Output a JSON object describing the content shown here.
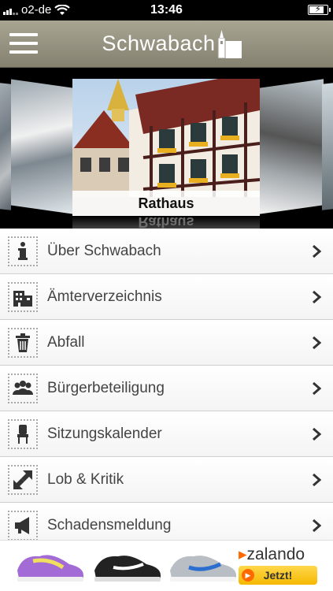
{
  "status": {
    "carrier": "o2-de",
    "time": "13:46",
    "battery_level": 0.85
  },
  "header": {
    "title": "Schwabach"
  },
  "carousel": {
    "current_caption": "Rathaus"
  },
  "menu": {
    "items": [
      {
        "label": "Über Schwabach",
        "icon": "info-icon"
      },
      {
        "label": "Ämterverzeichnis",
        "icon": "building-icon"
      },
      {
        "label": "Abfall",
        "icon": "trash-icon"
      },
      {
        "label": "Bürgerbeteiligung",
        "icon": "group-icon"
      },
      {
        "label": "Sitzungskalender",
        "icon": "chair-icon"
      },
      {
        "label": "Lob & Kritik",
        "icon": "arrows-icon"
      },
      {
        "label": "Schadensmeldung",
        "icon": "megaphone-icon"
      }
    ]
  },
  "ad": {
    "brand": "zalando",
    "cta_label": "Jetzt!"
  },
  "colors": {
    "navbar": "#99958a",
    "ad_accent": "#ff6900",
    "cta": "#f5c400"
  }
}
